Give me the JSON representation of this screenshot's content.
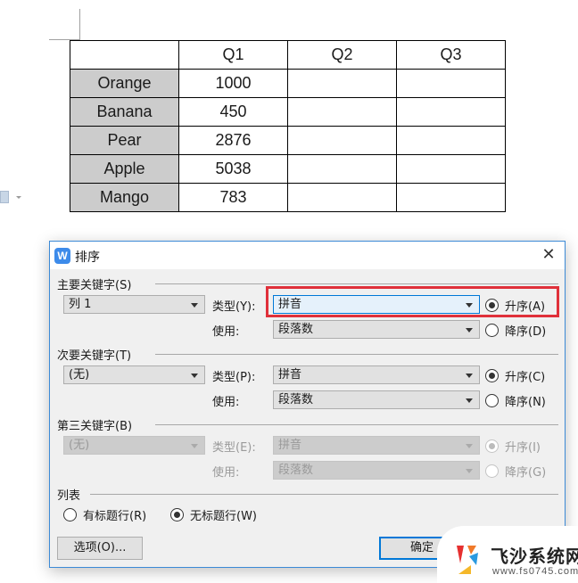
{
  "document": {
    "table": {
      "header": [
        "",
        "Q1",
        "Q2",
        "Q3"
      ],
      "rows": [
        {
          "label": "Orange",
          "q1": "1000",
          "q2": "",
          "q3": ""
        },
        {
          "label": "Banana",
          "q1": "450",
          "q2": "",
          "q3": ""
        },
        {
          "label": "Pear",
          "q1": "2876",
          "q2": "",
          "q3": ""
        },
        {
          "label": "Apple",
          "q1": "5038",
          "q2": "",
          "q3": ""
        },
        {
          "label": "Mango",
          "q1": "783",
          "q2": "",
          "q3": ""
        }
      ]
    }
  },
  "dialog": {
    "app_icon": "W",
    "title": "排序",
    "close": "✕",
    "primary_key": {
      "label": "主要关键字(S)",
      "column": "列 1",
      "type_label": "类型(Y):",
      "type_value": "拼音",
      "use_label": "使用:",
      "use_value": "段落数",
      "asc_label": "升序(A)",
      "desc_label": "降序(D)",
      "order": "asc"
    },
    "secondary_key": {
      "label": "次要关键字(T)",
      "column": "(无)",
      "type_label": "类型(P):",
      "type_value": "拼音",
      "use_label": "使用:",
      "use_value": "段落数",
      "asc_label": "升序(C)",
      "desc_label": "降序(N)",
      "order": "asc"
    },
    "third_key": {
      "label": "第三关键字(B)",
      "column": "(无)",
      "type_label": "类型(E):",
      "type_value": "拼音",
      "use_label": "使用:",
      "use_value": "段落数",
      "asc_label": "升序(I)",
      "desc_label": "降序(G)",
      "order": "asc",
      "disabled": true
    },
    "list": {
      "label": "列表",
      "has_header_label": "有标题行(R)",
      "no_header_label": "无标题行(W)",
      "selected": "no_header"
    },
    "options_button": "选项(O)...",
    "ok_button": "确定"
  },
  "watermark": {
    "title": "飞沙系统网",
    "url": "www.fs0745.com"
  }
}
